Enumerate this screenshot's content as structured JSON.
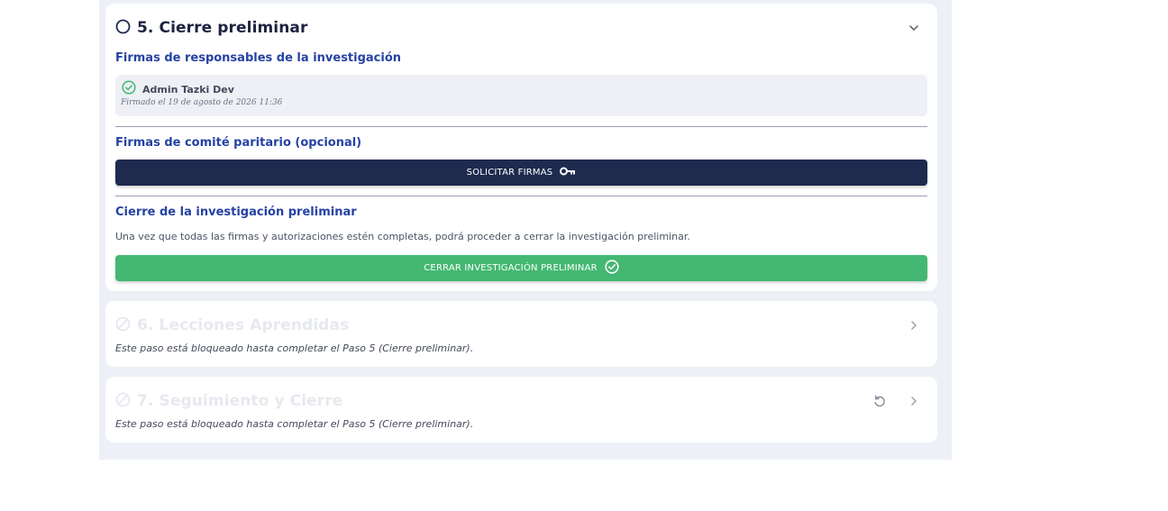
{
  "steps": {
    "step5": {
      "title": "5. Cierre preliminar",
      "sections": {
        "responsables_title": "Firmas de responsables de la investigación",
        "signer": {
          "name": "Admin Tazki Dev",
          "signed_at": "Firmado el 19 de agosto de 2026 11:36"
        },
        "comite_title": "Firmas de comité paritario (opcional)",
        "request_signatures_label": "SOLICITAR FIRMAS",
        "cierre_title": "Cierre de la investigación preliminar",
        "cierre_description": "Una vez que todas las firmas y autorizaciones estén completas, podrá proceder a cerrar la investigación preliminar.",
        "close_button_label": "CERRAR INVESTIGACIÓN PRELIMINAR"
      }
    },
    "step6": {
      "title": "6. Lecciones Aprendidas",
      "locked_message": "Este paso está bloqueado hasta completar el Paso 5 (Cierre preliminar)."
    },
    "step7": {
      "title": "7. Seguimiento y Cierre",
      "locked_message": "Este paso está bloqueado hasta completar el Paso 5 (Cierre preliminar)."
    }
  },
  "icons": {
    "step5_status": "circle-outline-icon",
    "step5_toggle": "chevron-down-icon",
    "signed": "check-circle-icon",
    "request": "key-icon",
    "close": "check-circle-icon",
    "locked_status": "blocked-circle-icon",
    "expand": "chevron-right-icon",
    "reset": "undo-icon"
  },
  "colors": {
    "primary_dark": "#1e2b4e",
    "section_blue": "#2642a3",
    "success_green": "#44b872",
    "panel_bg": "#eef0f8"
  }
}
